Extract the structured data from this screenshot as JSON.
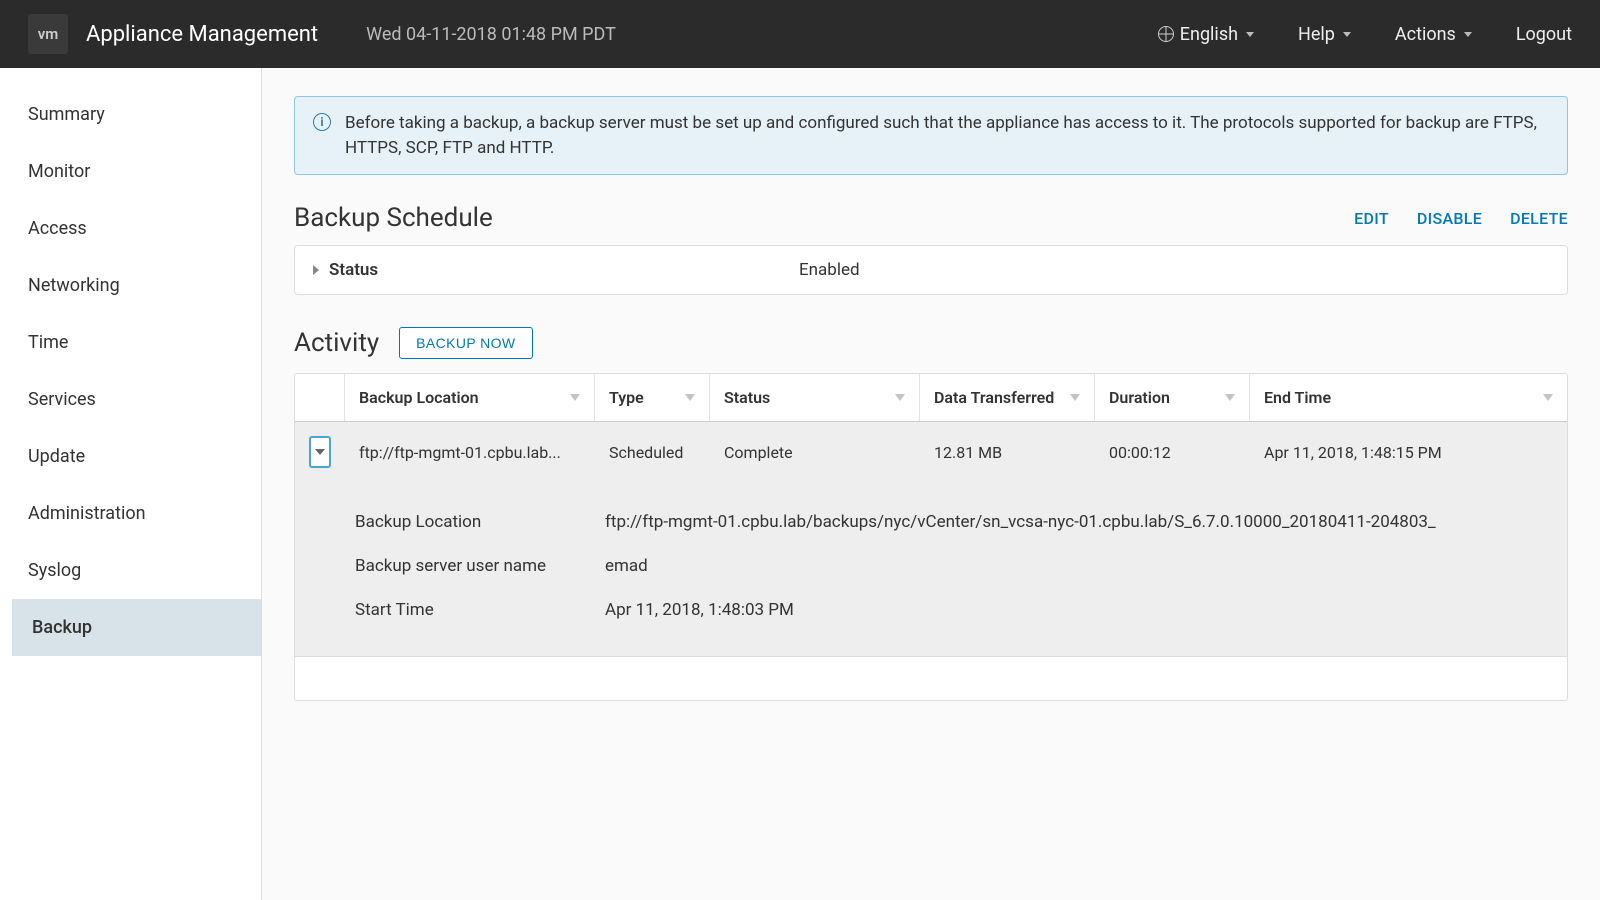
{
  "header": {
    "logo_text": "vm",
    "app_title": "Appliance Management",
    "datetime": "Wed 04-11-2018 01:48 PM PDT",
    "language": "English",
    "help": "Help",
    "actions": "Actions",
    "logout": "Logout"
  },
  "sidebar": {
    "items": [
      "Summary",
      "Monitor",
      "Access",
      "Networking",
      "Time",
      "Services",
      "Update",
      "Administration",
      "Syslog",
      "Backup"
    ],
    "active_index": 9
  },
  "banner": {
    "text": "Before taking a backup, a backup server must be set up and configured such that the appliance has access to it. The protocols supported for backup are FTPS, HTTPS, SCP, FTP and HTTP."
  },
  "schedule": {
    "title": "Backup Schedule",
    "actions": {
      "edit": "EDIT",
      "disable": "DISABLE",
      "delete": "DELETE"
    },
    "status_label": "Status",
    "status_value": "Enabled"
  },
  "activity": {
    "title": "Activity",
    "backup_now": "BACKUP NOW",
    "columns": {
      "location": "Backup Location",
      "type": "Type",
      "status": "Status",
      "data": "Data Transferred",
      "duration": "Duration",
      "end": "End Time"
    },
    "row": {
      "location_short": "ftp://ftp-mgmt-01.cpbu.lab...",
      "type": "Scheduled",
      "status": "Complete",
      "data": "12.81 MB",
      "duration": "00:00:12",
      "end": "Apr 11, 2018, 1:48:15 PM"
    },
    "detail": {
      "location_label": "Backup Location",
      "location_value": "ftp://ftp-mgmt-01.cpbu.lab/backups/nyc/vCenter/sn_vcsa-nyc-01.cpbu.lab/S_6.7.0.10000_20180411-204803_",
      "user_label": "Backup server user name",
      "user_value": "emad",
      "start_label": "Start Time",
      "start_value": "Apr 11, 2018, 1:48:03 PM"
    }
  }
}
